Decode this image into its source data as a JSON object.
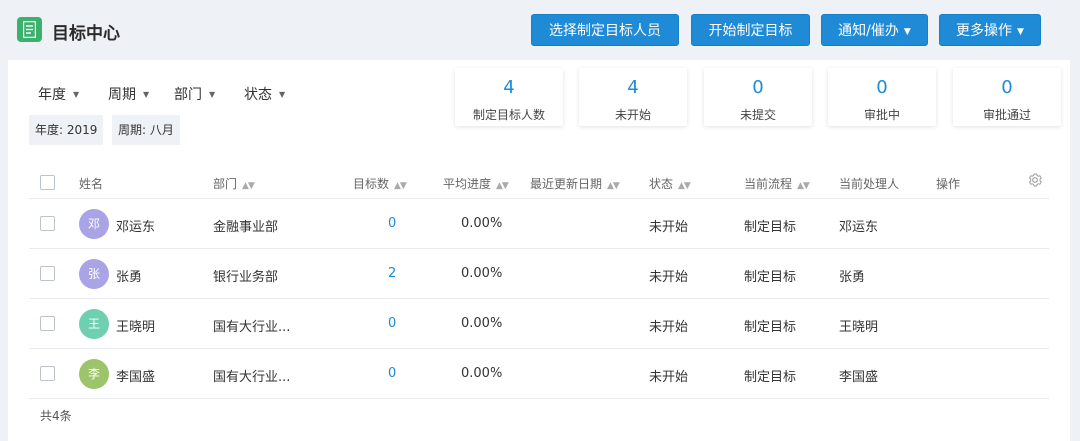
{
  "header": {
    "title": "目标中心",
    "buttons": {
      "select_people": "选择制定目标人员",
      "start_setting": "开始制定目标",
      "notify": "通知/催办",
      "more": "更多操作"
    }
  },
  "filters": {
    "year": "年度",
    "cycle": "周期",
    "department": "部门",
    "status": "状态"
  },
  "tags": {
    "year": "年度: 2019",
    "cycle": "周期: 八月"
  },
  "stats": [
    {
      "value": "4",
      "label": "制定目标人数"
    },
    {
      "value": "4",
      "label": "未开始"
    },
    {
      "value": "0",
      "label": "未提交"
    },
    {
      "value": "0",
      "label": "审批中"
    },
    {
      "value": "0",
      "label": "审批通过"
    }
  ],
  "table": {
    "columns": {
      "name": "姓名",
      "department": "部门",
      "goal_count": "目标数",
      "avg_progress": "平均进度",
      "last_update": "最近更新日期",
      "status": "状态",
      "flow": "当前流程",
      "handler": "当前处理人",
      "action": "操作"
    },
    "rows": [
      {
        "avatar": "邓",
        "avatar_color": "#a8a4e6",
        "name": "邓运东",
        "department": "金融事业部",
        "goal_count": "0",
        "avg_progress": "0.00%",
        "last_update": "",
        "status": "未开始",
        "flow": "制定目标",
        "handler": "邓运东"
      },
      {
        "avatar": "张",
        "avatar_color": "#a8a4e6",
        "name": "张勇",
        "department": "银行业务部",
        "goal_count": "2",
        "avg_progress": "0.00%",
        "last_update": "",
        "status": "未开始",
        "flow": "制定目标",
        "handler": "张勇"
      },
      {
        "avatar": "王",
        "avatar_color": "#6fcfb1",
        "name": "王晓明",
        "department": "国有大行业...",
        "goal_count": "0",
        "avg_progress": "0.00%",
        "last_update": "",
        "status": "未开始",
        "flow": "制定目标",
        "handler": "王晓明"
      },
      {
        "avatar": "李",
        "avatar_color": "#9cc46a",
        "name": "李国盛",
        "department": "国有大行业...",
        "goal_count": "0",
        "avg_progress": "0.00%",
        "last_update": "",
        "status": "未开始",
        "flow": "制定目标",
        "handler": "李国盛"
      }
    ],
    "total": "共4条"
  },
  "colors": {
    "primary": "#1f8ad6",
    "app_icon": "#3cb16e"
  },
  "icons": {
    "app": "document-icon",
    "settings": "gear-icon",
    "dropdown": "caret-down-icon",
    "sort": "sort-icon"
  }
}
